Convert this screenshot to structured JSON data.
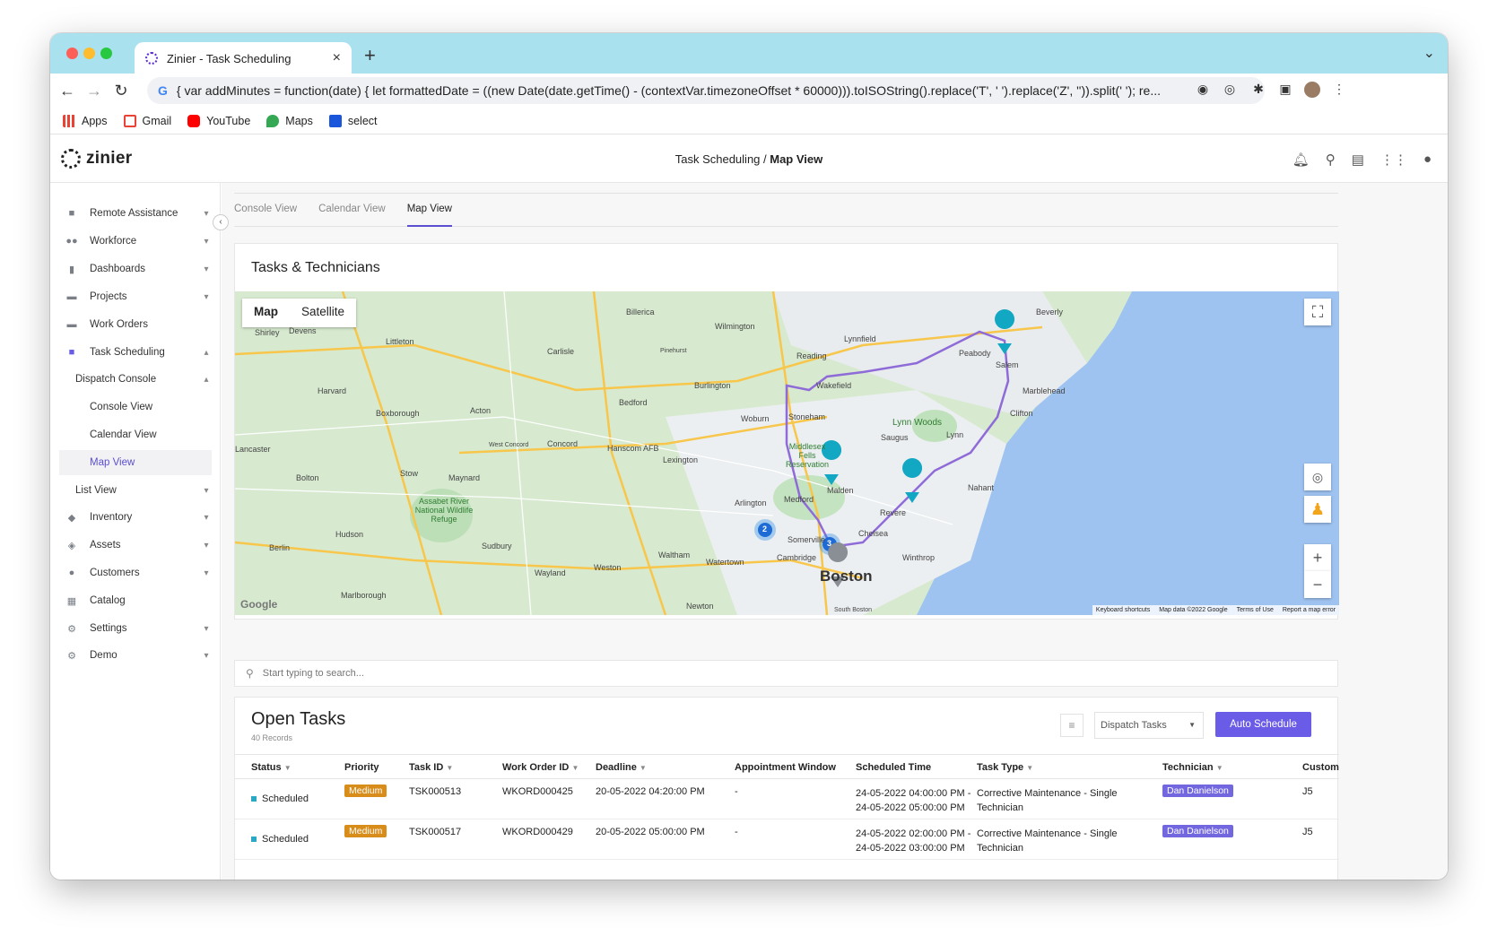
{
  "browser": {
    "tab_title": "Zinier - Task Scheduling",
    "url": "{ var addMinutes = function(date) { let formattedDate = ((new Date(date.getTime() - (contextVar.timezoneOffset * 60000))).toISOString().replace('T', ' ').replace('Z', '')).split(' '); re...",
    "bookmarks": [
      "Apps",
      "Gmail",
      "YouTube",
      "Maps",
      "select"
    ]
  },
  "app": {
    "logo": "zinier",
    "breadcrumb_parent": "Task Scheduling",
    "breadcrumb_sep": " / ",
    "breadcrumb_current": "Map View"
  },
  "sidebar": {
    "items": [
      {
        "label": "Remote Assistance",
        "icon": "video-icon",
        "expand": "▾"
      },
      {
        "label": "Workforce",
        "icon": "people-icon",
        "expand": "▾"
      },
      {
        "label": "Dashboards",
        "icon": "chart-icon",
        "expand": "▾"
      },
      {
        "label": "Projects",
        "icon": "folder-icon",
        "expand": "▾"
      },
      {
        "label": "Work Orders",
        "icon": "folder-icon",
        "expand": ""
      },
      {
        "label": "Task Scheduling",
        "icon": "schedule-icon",
        "expand": "▴"
      },
      {
        "label": "Dispatch Console",
        "icon": "",
        "expand": "▴"
      },
      {
        "label": "Console View",
        "icon": "",
        "expand": ""
      },
      {
        "label": "Calendar View",
        "icon": "",
        "expand": ""
      },
      {
        "label": "Map View",
        "icon": "",
        "expand": ""
      },
      {
        "label": "List View",
        "icon": "",
        "expand": "▾"
      },
      {
        "label": "Inventory",
        "icon": "inventory-icon",
        "expand": "▾"
      },
      {
        "label": "Assets",
        "icon": "assets-icon",
        "expand": "▾"
      },
      {
        "label": "Customers",
        "icon": "customer-icon",
        "expand": "▾"
      },
      {
        "label": "Catalog",
        "icon": "catalog-icon",
        "expand": ""
      },
      {
        "label": "Settings",
        "icon": "gear-icon",
        "expand": "▾"
      },
      {
        "label": "Demo",
        "icon": "gear-icon",
        "expand": "▾"
      }
    ]
  },
  "subtabs": [
    "Console View",
    "Calendar View",
    "Map View"
  ],
  "map_card": {
    "title": "Tasks & Technicians",
    "toggle_map": "Map",
    "toggle_satellite": "Satellite",
    "footer": [
      "Keyboard shortcuts",
      "Map data ©2022 Google",
      "Terms of Use",
      "Report a map error"
    ],
    "google": "Google",
    "cluster_labels": [
      "2",
      "3"
    ],
    "places": [
      "Billerica",
      "Wilmington",
      "Beverly",
      "Lynnfield",
      "Peabody",
      "Salem",
      "Reading",
      "Wakefield",
      "Marblehead",
      "Burlington",
      "Bedford",
      "Woburn",
      "Stoneham",
      "Lynn Woods",
      "Saugus",
      "Lynn",
      "Clifton",
      "Lexington",
      "Hanscom AFB",
      "Concord",
      "Acton",
      "Harvard",
      "Boxborough",
      "Littleton",
      "Carlisle",
      "Devens",
      "Shirley",
      "Malden",
      "Medford",
      "Arlington",
      "Revere",
      "Nahant",
      "Somerville",
      "Chelsea",
      "Winthrop",
      "Cambridge",
      "Boston",
      "Waltham",
      "Watertown",
      "Newton",
      "Weston",
      "Wayland",
      "Sudbury",
      "Maynard",
      "Stow",
      "Hudson",
      "Bolton",
      "Berlin",
      "Marlborough",
      "Lancaster",
      "Assabet River National Wildlife Refuge",
      "Middlesex Fells Reservation",
      "West Concord",
      "Pinehurst",
      "South Boston"
    ]
  },
  "search": {
    "placeholder": "Start typing to search..."
  },
  "open_tasks": {
    "title": "Open Tasks",
    "records": "40 Records",
    "dispatch_select": "Dispatch Tasks",
    "auto_schedule": "Auto Schedule",
    "columns": [
      "Status",
      "Priority",
      "Task ID",
      "Work Order ID",
      "Deadline",
      "Appointment Window",
      "Scheduled Time",
      "Task Type",
      "Technician",
      "Custom"
    ],
    "rows": [
      {
        "status": "Scheduled",
        "priority": "Medium",
        "task_id": "TSK000513",
        "work_order": "WKORD000425",
        "deadline": "20-05-2022 04:20:00 PM",
        "appt": "-",
        "sched1": "24-05-2022 04:00:00 PM -",
        "sched2": "24-05-2022 05:00:00 PM",
        "type1": "Corrective Maintenance - Single",
        "type2": "Technician",
        "tech": "Dan Danielson",
        "cust": "J5"
      },
      {
        "status": "Scheduled",
        "priority": "Medium",
        "task_id": "TSK000517",
        "work_order": "WKORD000429",
        "deadline": "20-05-2022 05:00:00 PM",
        "appt": "-",
        "sched1": "24-05-2022 02:00:00 PM -",
        "sched2": "24-05-2022 03:00:00 PM",
        "type1": "Corrective Maintenance - Single",
        "type2": "Technician",
        "tech": "Dan Danielson",
        "cust": "J5"
      }
    ]
  },
  "colors": {
    "accent": "#6b5ce7",
    "tab_strip": "#a9e1ee",
    "priority_medium": "#d88c1a",
    "status_scheduled": "#2aa8c4"
  }
}
